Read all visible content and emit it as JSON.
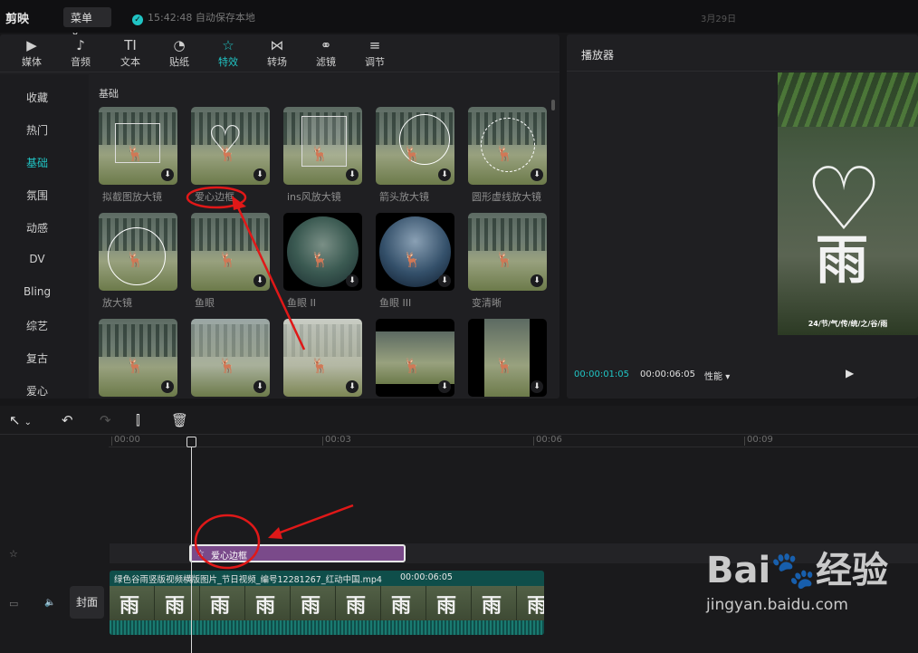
{
  "app": {
    "logo": "剪映",
    "menu_label": "菜单",
    "save_status": "15:42:48 自动保存本地",
    "date": "3月29日"
  },
  "tabs": [
    {
      "label": "媒体",
      "icon": "media-icon",
      "glyph": "▶"
    },
    {
      "label": "音频",
      "icon": "audio-icon",
      "glyph": "♪"
    },
    {
      "label": "文本",
      "icon": "text-icon",
      "glyph": "TI"
    },
    {
      "label": "贴纸",
      "icon": "sticker-icon",
      "glyph": "◔"
    },
    {
      "label": "特效",
      "icon": "effects-icon",
      "glyph": "☆"
    },
    {
      "label": "转场",
      "icon": "transition-icon",
      "glyph": "⋈"
    },
    {
      "label": "滤镜",
      "icon": "filter-icon",
      "glyph": "⚭"
    },
    {
      "label": "调节",
      "icon": "adjust-icon",
      "glyph": "≡"
    }
  ],
  "active_tab": "特效",
  "sidebar": {
    "items": [
      "收藏",
      "热门",
      "基础",
      "氛围",
      "动感",
      "DV",
      "Bling",
      "综艺",
      "复古",
      "爱心"
    ],
    "active": "基础"
  },
  "section_title": "基础",
  "effects": [
    {
      "label": "拟截图放大镜"
    },
    {
      "label": "爱心边框"
    },
    {
      "label": "ins风放大镜"
    },
    {
      "label": "箭头放大镜"
    },
    {
      "label": "圆形虚线放大镜"
    },
    {
      "label": "放大镜"
    },
    {
      "label": "鱼眼"
    },
    {
      "label": "鱼眼 II"
    },
    {
      "label": "鱼眼 III"
    },
    {
      "label": "变清晰"
    },
    {
      "label": ""
    },
    {
      "label": ""
    },
    {
      "label": ""
    },
    {
      "label": ""
    },
    {
      "label": ""
    }
  ],
  "player": {
    "title": "播放器",
    "current_time": "00:00:01:05",
    "total_time": "00:00:06:05",
    "performance_label": "性能",
    "preview_caption": "24/节/气/传/统/之/谷/雨"
  },
  "timeline": {
    "ruler_ticks": [
      "00:00",
      "00:03",
      "00:06",
      "00:09"
    ],
    "fx_clip_label": "爱心边框",
    "video_clip_name": "绿色谷雨竖版视频横版图片_节日视频_编号12281267_红动中国.mp4",
    "video_clip_duration": "00:00:06:05",
    "cover_label": "封面"
  },
  "watermark": {
    "logo": "Bai🐾经验",
    "url": "jingyan.baidu.com"
  },
  "colors": {
    "accent": "#20c4c4",
    "fx_clip": "#7a4a8a",
    "video_clip": "#0f4e4a",
    "annotation": "#e01818"
  }
}
